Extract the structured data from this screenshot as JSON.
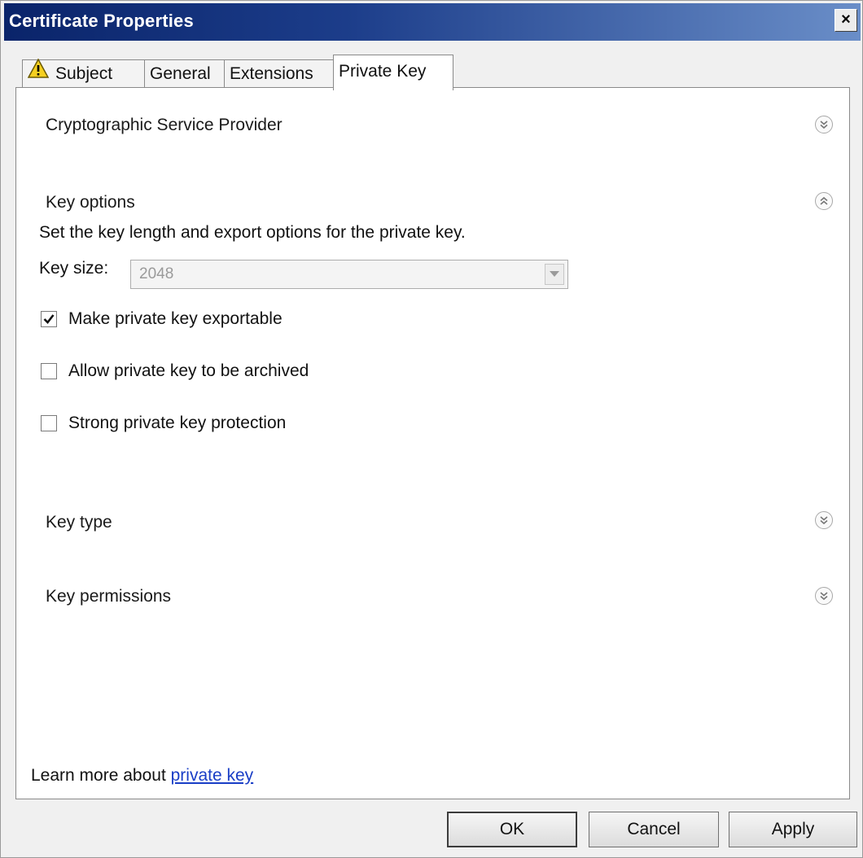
{
  "window": {
    "title": "Certificate Properties",
    "close_glyph": "×"
  },
  "tabs": [
    {
      "label": "Subject",
      "icon": "warning-icon",
      "active": false
    },
    {
      "label": "General",
      "active": false
    },
    {
      "label": "Extensions",
      "active": false
    },
    {
      "label": "Private Key",
      "active": true
    }
  ],
  "sections": {
    "csp": {
      "label": "Cryptographic Service Provider",
      "state": "collapsed"
    },
    "key_options": {
      "label": "Key options",
      "state": "expanded",
      "description": "Set the key length and export options for the private key.",
      "key_size_label": "Key size:",
      "key_size_value": "2048",
      "checkboxes": [
        {
          "label": "Make private key exportable",
          "checked": true
        },
        {
          "label": "Allow private key to be archived",
          "checked": false
        },
        {
          "label": "Strong private key protection",
          "checked": false
        }
      ]
    },
    "key_type": {
      "label": "Key type",
      "state": "collapsed"
    },
    "key_permissions": {
      "label": "Key permissions",
      "state": "collapsed"
    }
  },
  "learn_more": {
    "prefix": "Learn more about ",
    "link": "private key"
  },
  "buttons": {
    "ok": "OK",
    "cancel": "Cancel",
    "apply": "Apply"
  },
  "colors": {
    "titlebar": "#0a246a",
    "link": "#1a3ec6"
  }
}
